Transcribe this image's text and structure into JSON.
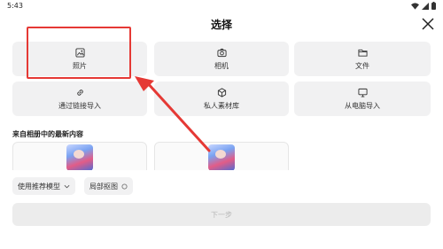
{
  "status_bar": {
    "time": "5:43",
    "icons": [
      "wifi-icon",
      "signal-icon",
      "battery-icon"
    ]
  },
  "header": {
    "title": "选择",
    "close_icon": "close-icon"
  },
  "options": [
    {
      "label": "照片",
      "icon": "photo-icon"
    },
    {
      "label": "相机",
      "icon": "camera-icon"
    },
    {
      "label": "文件",
      "icon": "folder-icon"
    },
    {
      "label": "通过链接导入",
      "icon": "link-icon"
    },
    {
      "label": "私人素材库",
      "icon": "cube-icon"
    },
    {
      "label": "从电脑导入",
      "icon": "monitor-icon"
    }
  ],
  "recent": {
    "title": "来自相册中的最新内容"
  },
  "chips": {
    "model": "使用推荐模型",
    "crop": "局部抠图"
  },
  "next_button": {
    "label": "下一步",
    "enabled": false
  },
  "colors": {
    "highlight": "#e53935",
    "tile_bg": "#f1f1f2",
    "disabled_text": "#b7b7b7"
  }
}
